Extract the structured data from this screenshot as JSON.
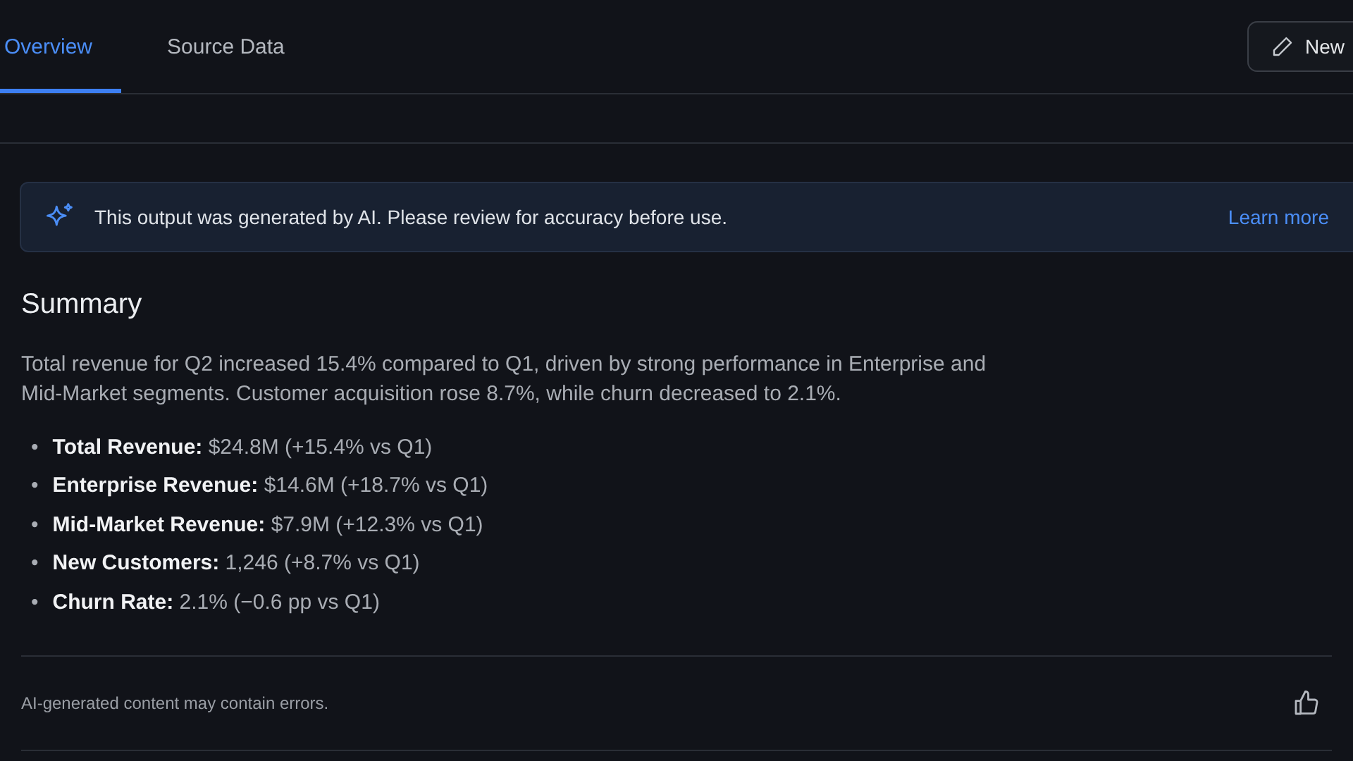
{
  "tabs": [
    {
      "label": "Overview",
      "selected": true
    },
    {
      "label": "Source Data",
      "selected": false
    }
  ],
  "new_button": {
    "label": "New"
  },
  "banner": {
    "text": "This output was generated by AI. Please review for accuracy before use.",
    "link": "Learn more"
  },
  "summary": {
    "title": "Summary",
    "paragraph": "Total revenue for Q2 increased 15.4% compared to Q1, driven by strong performance in Enterprise and Mid-Market segments. Customer acquisition rose 8.7%, while churn decreased to 2.1%.",
    "bullet": "•",
    "items": [
      {
        "label": "Total Revenue:",
        "value": "$24.8M (+15.4% vs Q1)"
      },
      {
        "label": "Enterprise Revenue:",
        "value": "$14.6M (+18.7% vs Q1)"
      },
      {
        "label": "Mid-Market Revenue:",
        "value": "$7.9M (+12.3% vs Q1)"
      },
      {
        "label": "New Customers:",
        "value": "1,246 (+8.7% vs Q1)"
      },
      {
        "label": "Churn Rate:",
        "value": "2.1% (−0.6 pp vs Q1)"
      }
    ]
  },
  "footer": {
    "disclaimer": "AI-generated content may contain errors."
  }
}
